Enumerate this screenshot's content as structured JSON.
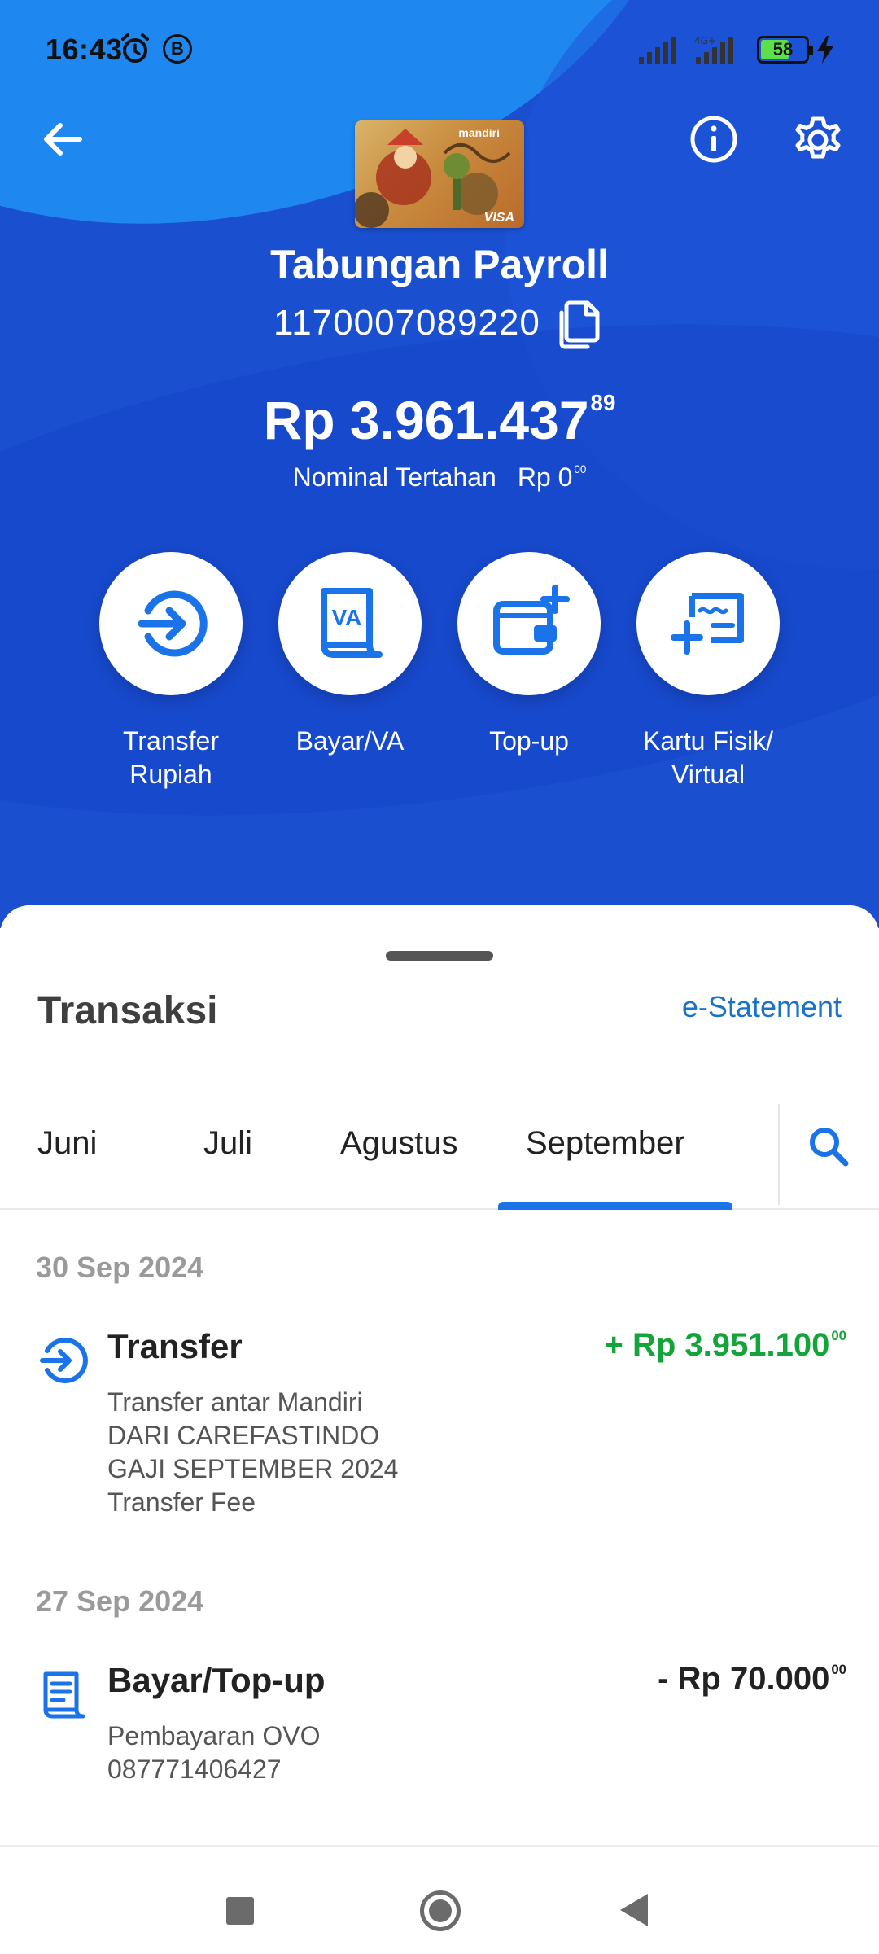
{
  "status_bar": {
    "time": "16:43",
    "b_badge": "B",
    "network": "4G+",
    "battery": "58",
    "battery_level": 0.58
  },
  "account": {
    "name": "Tabungan Payroll",
    "number": "1170007089220",
    "card_brand": "VISA",
    "card_bank": "mandiri"
  },
  "balance": {
    "main": "Rp 3.961.437",
    "cents": "89",
    "hold_label": "Nominal Tertahan",
    "hold_value": "Rp 0",
    "hold_cents": "00"
  },
  "actions": [
    {
      "label_line1": "Transfer",
      "label_line2": "Rupiah",
      "icon": "transfer-icon"
    },
    {
      "label_line1": "Bayar/VA",
      "label_line2": "",
      "icon": "va-bill-icon"
    },
    {
      "label_line1": "Top-up",
      "label_line2": "",
      "icon": "wallet-topup-icon"
    },
    {
      "label_line1": "Kartu Fisik/",
      "label_line2": "Virtual",
      "icon": "card-add-icon"
    }
  ],
  "transactions_section": {
    "title": "Transaksi",
    "estatement": "e-Statement",
    "tabs": [
      "Juni",
      "Juli",
      "Agustus",
      "September"
    ],
    "active_tab": "September"
  },
  "transactions": [
    {
      "date": "30 Sep 2024",
      "title": "Transfer",
      "amount": "+ Rp 3.951.100",
      "cents": "00",
      "desc": [
        "Transfer antar Mandiri",
        "DARI CAREFASTINDO",
        "GAJI SEPTEMBER 2024",
        "Transfer Fee"
      ],
      "icon": "transfer-icon"
    },
    {
      "date": "27 Sep 2024",
      "title": "Bayar/Top-up",
      "amount": "- Rp 70.000",
      "cents": "00",
      "desc": [
        "Pembayaran OVO",
        "087771406427"
      ],
      "icon": "bill-icon"
    }
  ],
  "colors": {
    "primary": "#1A4FD0",
    "accent_blue": "#1A73E8",
    "credit_green": "#13A43A"
  }
}
